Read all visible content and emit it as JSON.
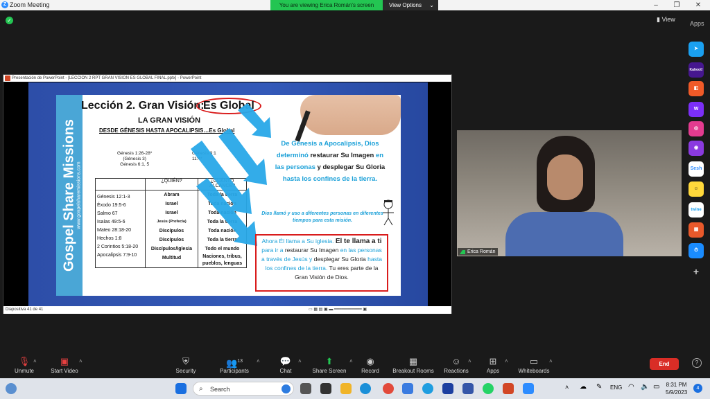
{
  "window": {
    "title": "Zoom Meeting",
    "viewing_banner": "You are viewing Erica Román's screen",
    "view_options_label": "View Options"
  },
  "top_right": {
    "view_label": "View",
    "apps_label": "Apps"
  },
  "sidebar_apps": [
    "Kahoot!",
    "Sesh",
    "twine"
  ],
  "ppt_window": {
    "title": "Presentación de PowerPoint - [LECCION 2 RPT GRAN VISION ES GLOBAL FINAL.pptx] - PowerPoint",
    "status": "Diapositiva 41 de 41"
  },
  "slide": {
    "lesson_title": "Lección 2. Gran Visión:",
    "lesson_highlight": "Es Global",
    "gran_vision": "LA GRAN VISIÓN",
    "subtitle": "DESDE GÉNESIS HASTA APOCALIPSIS…Es Global",
    "brand": "Gospel Share Missions",
    "brand_url": "www.gospelsharemissions.com",
    "genesis_refs": [
      "Génesis 1:26-28*",
      "(Génesis 3)",
      "Génesis 6:1, 5"
    ],
    "genesis_refs_right": [
      "Génesis 9:1",
      "11:4*"
    ],
    "table_headers": [
      "¿QUIÉN?",
      "¿CUÁNTO ALCANCE?"
    ],
    "table_refs": [
      "Génesis 12:1-3",
      "Éxodo 19:5-6",
      "Salmo 67",
      "Isaías 49:5-6",
      "Mateo 28:18-20",
      "Hechos 1:8",
      "2 Corintios 5:18-20",
      "Apocalipsis 7:9-10"
    ],
    "table_who": [
      "Abram",
      "Israel",
      "Israel",
      "Jesús (Profecía)",
      "Discípulos",
      "Discípulos",
      "Discípulos/Iglesia",
      "Multitud"
    ],
    "table_where": [
      "Toda la tierra",
      "Toda nación",
      "Toda nación",
      "Toda la tierra",
      "Toda nación",
      "Toda la tierra",
      "Todo el mundo",
      "Naciones, tribus, pueblos, lenguas"
    ],
    "blue_text_1": "De Génesis a Apocalipsis, Dios",
    "blue_text_2": "determinó",
    "blue_text_3": "restaurar Su Imagen",
    "blue_text_4": "en",
    "blue_text_5": "las personas",
    "blue_text_6": "y desplegar Su Gloria",
    "blue_text_7": "hasta los confines de la tierra.",
    "italic_text": "Dios llamó y uso a diferentes personas en diferentes tiempos para esta misión.",
    "call_1": "Ahora Él llama a Su iglesia.",
    "call_2": "El te llama a ti",
    "call_3": "para ir a",
    "call_4": "restaurar Su Imagen",
    "call_5": "en las personas a través de Jesús y",
    "call_6": "desplegar Su Gloria",
    "call_7": "hasta los confines de la tierra.",
    "call_8": "Tu eres parte de la Gran Visión de Dios."
  },
  "video": {
    "participant_name": "Erica Román"
  },
  "toolbar": {
    "unmute": "Unmute",
    "start_video": "Start Video",
    "security": "Security",
    "participants": "Participants",
    "participants_count": "13",
    "chat": "Chat",
    "share_screen": "Share Screen",
    "record": "Record",
    "breakout_rooms": "Breakout Rooms",
    "reactions": "Reactions",
    "apps": "Apps",
    "whiteboards": "Whiteboards",
    "end": "End"
  },
  "taskbar": {
    "search_placeholder": "Search",
    "language": "ENG",
    "time": "8:31 PM",
    "date": "5/9/2023",
    "notification_count": "4"
  },
  "colors": {
    "zoom_green": "#23c552",
    "end_red": "#d92d26",
    "slide_blue": "#3359b8",
    "text_cyan": "#1aa0d8"
  }
}
